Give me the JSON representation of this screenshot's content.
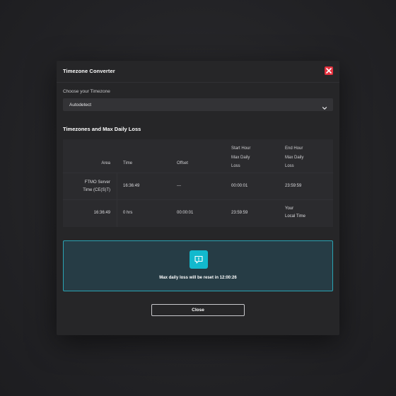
{
  "modal": {
    "title": "Timezone Converter",
    "close_icon": "close-icon",
    "accent_color": "#e5323f"
  },
  "timezone_select": {
    "label": "Choose your Timezone",
    "value": "Autodetect",
    "icon": "chevron-down-icon"
  },
  "section": {
    "title": "Timezones and Max Daily Loss"
  },
  "table": {
    "headers": {
      "area": "Area",
      "time": "Time",
      "offset": "Offset",
      "start_line1": "Start Hour",
      "start_line2": "Max Daily",
      "start_line3": "Loss",
      "end_line1": "End Hour",
      "end_line2": "Max Daily",
      "end_line3": "Loss"
    },
    "rows": [
      {
        "area_line1": "FTMO Server",
        "area_line2": "Time (CE(S)T)",
        "time": "16:36:49",
        "offset": "---",
        "start": "00:00:01",
        "end": "23:59:59"
      },
      {
        "area": "16:36:49",
        "time": "0 hrs",
        "offset": "00:00:01",
        "start": "23:59:59",
        "end_line1": "Your",
        "end_line2": "Local Time"
      }
    ]
  },
  "info": {
    "icon": "info-icon",
    "message": "Max daily loss will be reset in 12:00:26",
    "accent_color": "#12b9cd"
  },
  "footer": {
    "close_label": "Close"
  }
}
